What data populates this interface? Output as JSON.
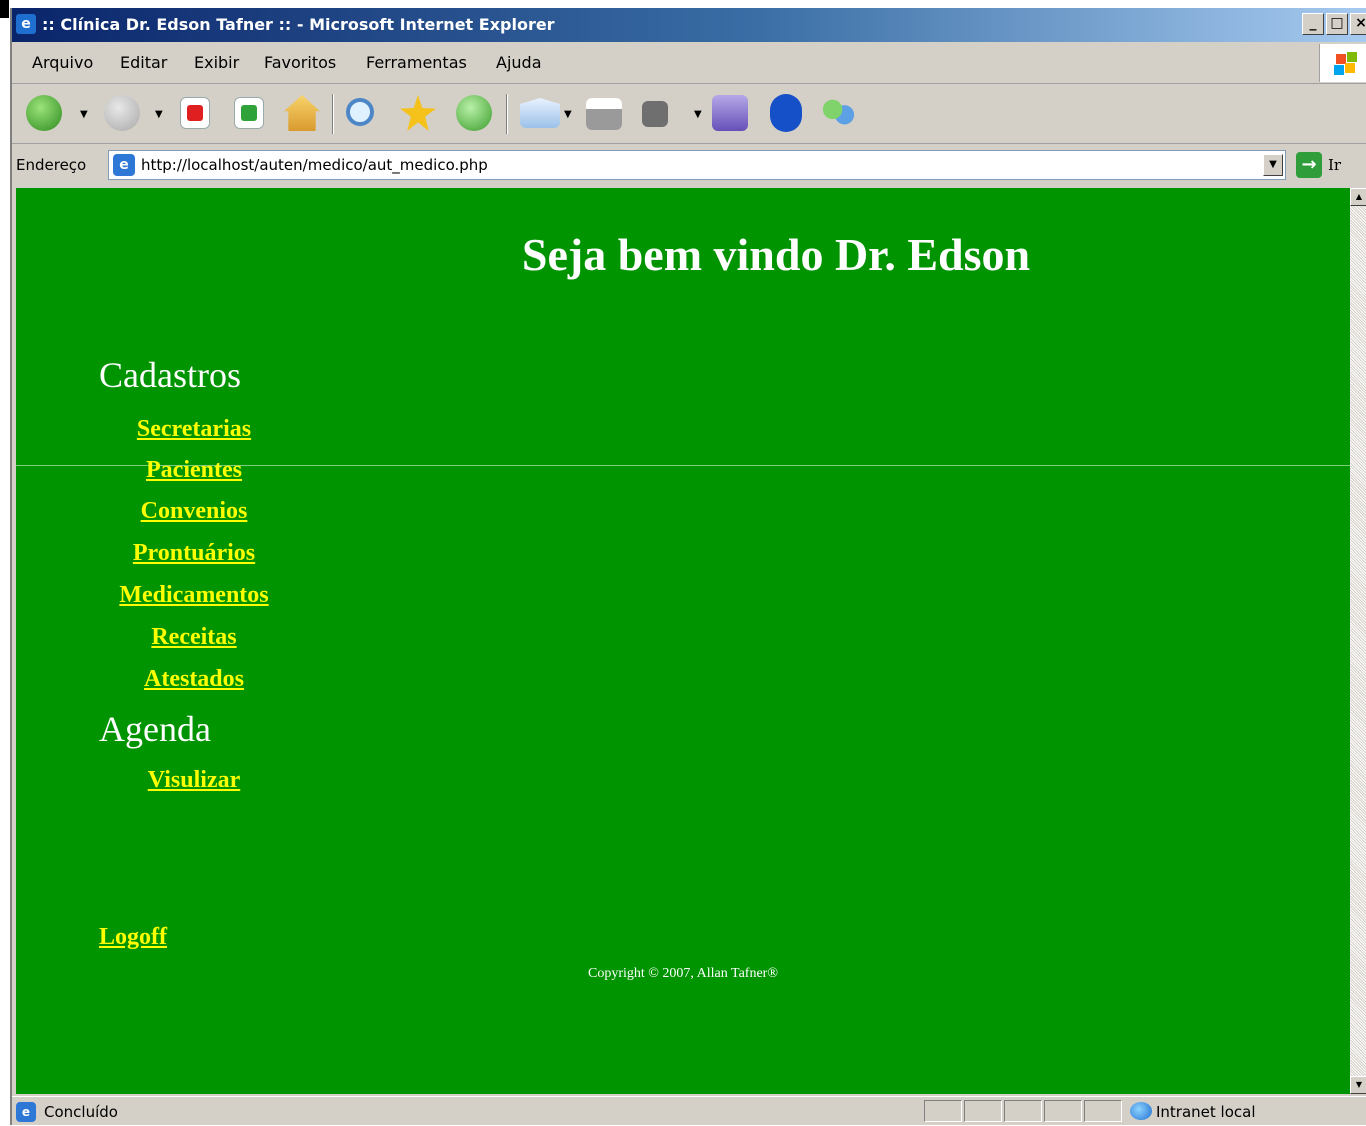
{
  "window": {
    "title": ":: Clínica Dr. Edson Tafner :: - Microsoft Internet Explorer",
    "controls": [
      "_",
      "□",
      "×"
    ]
  },
  "menu": [
    "Arquivo",
    "Editar",
    "Exibir",
    "Favoritos",
    "Ferramentas",
    "Ajuda"
  ],
  "toolbar_icons": [
    "back-icon",
    "forward-icon",
    "stop-icon",
    "refresh-icon",
    "home-icon",
    "search-icon",
    "favorites-icon",
    "history-icon",
    "mail-icon",
    "print-icon",
    "edit-icon",
    "messenger-icon",
    "bluetooth-icon",
    "contacts-icon"
  ],
  "address": {
    "label": "Endereço",
    "url": "http://localhost/auten/medico/aut_medico.php",
    "go_label": "Ir"
  },
  "page": {
    "heading": "Seja bem vindo Dr. Edson",
    "sections": [
      {
        "title": "Cadastros",
        "links": [
          "Secretarias",
          "Pacientes",
          "Convenios",
          "Prontuários",
          "Medicamentos",
          "Receitas",
          "Atestados"
        ]
      },
      {
        "title": "Agenda",
        "links": [
          "Visulizar"
        ]
      }
    ],
    "logoff": "Logoff",
    "copyright": "Copyright © 2007, Allan Tafner®"
  },
  "status": {
    "text": "Concluído",
    "zone": "Intranet local"
  },
  "colors": {
    "page_background": "#009400",
    "link": "#ffff00",
    "heading": "#ffffff"
  }
}
